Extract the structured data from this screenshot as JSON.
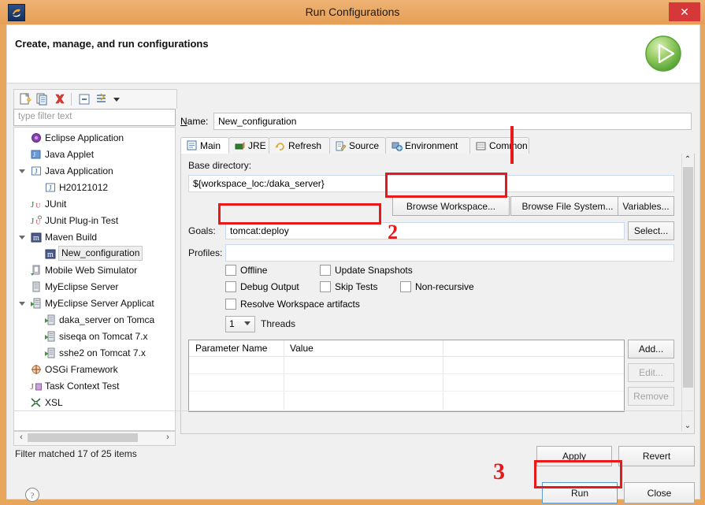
{
  "window": {
    "title": "Run Configurations",
    "app_icon": "eclipse-icon",
    "close_label": "✕"
  },
  "header": {
    "title": "Create, manage, and run configurations",
    "icon": "green-run-arrow-icon"
  },
  "tree_toolbar": {
    "items": [
      {
        "name": "new-configuration-icon",
        "label": "New launch configuration"
      },
      {
        "name": "duplicate-icon",
        "label": "Duplicate"
      },
      {
        "name": "delete-icon",
        "label": "Delete"
      },
      {
        "name": "collapse-all-icon",
        "label": "Collapse All"
      },
      {
        "name": "filter-icon",
        "label": "Filter"
      },
      {
        "name": "chevron-down-icon",
        "label": "Menu"
      }
    ]
  },
  "filter": {
    "placeholder": "type filter text",
    "status": "Filter matched 17 of 25 items"
  },
  "tree": {
    "items": [
      {
        "label": "Eclipse Application",
        "indent": 0,
        "icon": "eclipse-app-icon",
        "twisty": "none",
        "selected": false
      },
      {
        "label": "Java Applet",
        "indent": 0,
        "icon": "java-applet-icon",
        "twisty": "none",
        "selected": false
      },
      {
        "label": "Java Application",
        "indent": 0,
        "icon": "java-app-icon",
        "twisty": "open",
        "selected": false
      },
      {
        "label": "H20121012",
        "indent": 1,
        "icon": "java-app-icon",
        "twisty": "none",
        "selected": false
      },
      {
        "label": "JUnit",
        "indent": 0,
        "icon": "junit-icon",
        "twisty": "none",
        "selected": false
      },
      {
        "label": "JUnit Plug-in Test",
        "indent": 0,
        "icon": "junit-plugin-icon",
        "twisty": "none",
        "selected": false
      },
      {
        "label": "Maven Build",
        "indent": 0,
        "icon": "maven-icon",
        "twisty": "open",
        "selected": false
      },
      {
        "label": "New_configuration",
        "indent": 1,
        "icon": "maven-icon",
        "twisty": "none",
        "selected": true
      },
      {
        "label": "Mobile Web Simulator",
        "indent": 0,
        "icon": "mobile-sim-icon",
        "twisty": "none",
        "selected": false
      },
      {
        "label": "MyEclipse Server",
        "indent": 0,
        "icon": "server-icon",
        "twisty": "none",
        "selected": false
      },
      {
        "label": "MyEclipse Server Applicat",
        "indent": 0,
        "icon": "server-app-icon",
        "twisty": "open",
        "selected": false
      },
      {
        "label": "daka_server on Tomca",
        "indent": 1,
        "icon": "server-app-icon",
        "twisty": "none",
        "selected": false
      },
      {
        "label": "siseqa on Tomcat  7.x",
        "indent": 1,
        "icon": "server-app-icon",
        "twisty": "none",
        "selected": false
      },
      {
        "label": "sshe2 on Tomcat  7.x",
        "indent": 1,
        "icon": "server-app-icon",
        "twisty": "none",
        "selected": false
      },
      {
        "label": "OSGi Framework",
        "indent": 0,
        "icon": "osgi-icon",
        "twisty": "none",
        "selected": false
      },
      {
        "label": "Task Context Test",
        "indent": 0,
        "icon": "junit-task-icon",
        "twisty": "none",
        "selected": false
      },
      {
        "label": "XSL",
        "indent": 0,
        "icon": "xsl-icon",
        "twisty": "none",
        "selected": false
      }
    ]
  },
  "config": {
    "name_label": "Name:",
    "name_value": "New_configuration",
    "tabs": [
      {
        "label": "Main",
        "icon": "main-tab-icon",
        "active": true
      },
      {
        "label": "JRE",
        "icon": "jre-tab-icon",
        "active": false
      },
      {
        "label": "Refresh",
        "icon": "refresh-tab-icon",
        "active": false
      },
      {
        "label": "Source",
        "icon": "source-tab-icon",
        "active": false
      },
      {
        "label": "Environment",
        "icon": "environment-tab-icon",
        "active": false
      },
      {
        "label": "Common",
        "icon": "common-tab-icon",
        "active": false
      }
    ]
  },
  "main_tab": {
    "base_directory_label": "Base directory:",
    "base_directory_value": "${workspace_loc:/daka_server}",
    "browse_workspace": "Browse Workspace...",
    "browse_file_system": "Browse File System...",
    "variables": "Variables...",
    "goals_label": "Goals:",
    "goals_value": "tomcat:deploy",
    "goals_select": "Select...",
    "profiles_label": "Profiles:",
    "profiles_value": "",
    "checkboxes": [
      {
        "label": "Offline",
        "checked": false
      },
      {
        "label": "Update Snapshots",
        "checked": false
      },
      {
        "label": "Debug Output",
        "checked": false
      },
      {
        "label": "Skip Tests",
        "checked": false
      },
      {
        "label": "Non-recursive",
        "checked": false
      },
      {
        "label": "Resolve Workspace artifacts",
        "checked": false
      }
    ],
    "threads_value": "1",
    "threads_label": "Threads",
    "table": {
      "columns": [
        "Parameter Name",
        "Value"
      ],
      "rows": []
    },
    "table_buttons": [
      {
        "label": "Add...",
        "enabled": true
      },
      {
        "label": "Edit...",
        "enabled": false
      },
      {
        "label": "Remove",
        "enabled": false
      }
    ]
  },
  "footer": {
    "apply": "Apply",
    "revert": "Revert",
    "run": "Run",
    "close": "Close",
    "help_icon": "help-icon"
  },
  "annotations": {
    "markers": [
      {
        "label": "1",
        "type": "line"
      },
      {
        "label": "2",
        "type": "number"
      },
      {
        "label": "3",
        "type": "number"
      }
    ],
    "color": "#e8191a",
    "num2": "2",
    "num3": "3"
  }
}
